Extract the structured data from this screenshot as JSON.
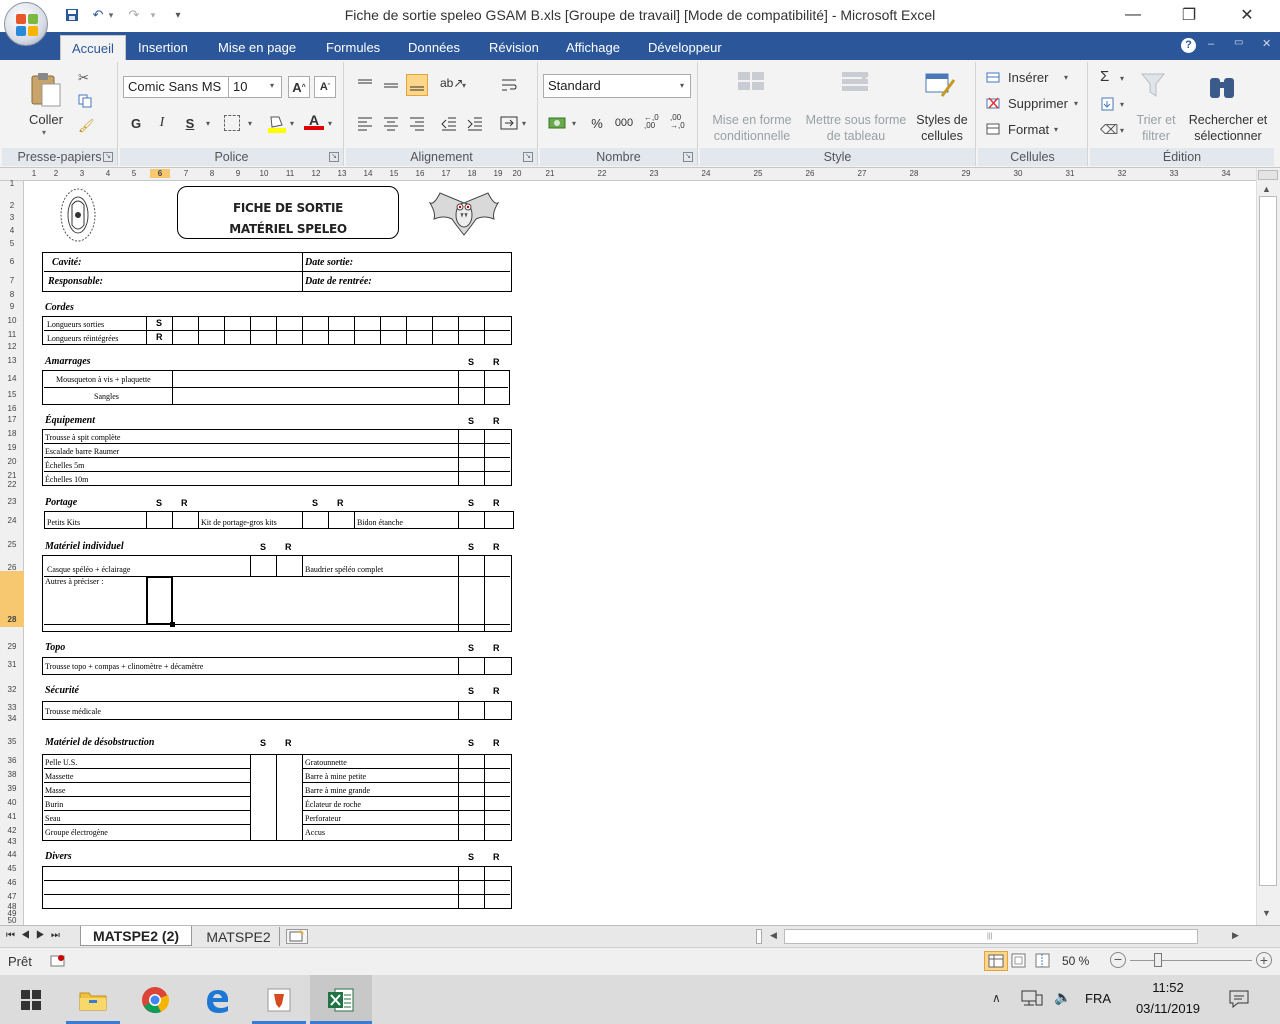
{
  "window": {
    "title": "Fiche de sortie speleo GSAM B.xls  [Groupe de travail]  [Mode de compatibilité] - Microsoft Excel",
    "minimize": "—",
    "maximize": "❐",
    "close": "✕"
  },
  "qat": {
    "save": "💾",
    "undo": "↶",
    "redo": "↷",
    "customize": "▾"
  },
  "tabs": [
    "Accueil",
    "Insertion",
    "Mise en page",
    "Formules",
    "Données",
    "Révision",
    "Affichage",
    "Développeur"
  ],
  "ribbon": {
    "clipboard": {
      "label": "Presse-papiers",
      "paste": "Coller"
    },
    "font": {
      "label": "Police",
      "font_name": "Comic Sans MS",
      "font_size": "10",
      "bold": "G",
      "italic": "I",
      "underline": "S"
    },
    "alignment": {
      "label": "Alignement"
    },
    "number": {
      "label": "Nombre",
      "format": "Standard",
      "percent": "%",
      "thousands": "000"
    },
    "style": {
      "label": "Style",
      "conditional": "Mise en forme conditionnelle",
      "table": "Mettre sous forme de tableau",
      "cell_styles": "Styles de cellules"
    },
    "cells": {
      "label": "Cellules",
      "insert": "Insérer",
      "delete": "Supprimer",
      "format": "Format"
    },
    "editing": {
      "label": "Édition",
      "sum": "Σ",
      "sort": "Trier et filtrer",
      "find": "Rechercher et sélectionner"
    }
  },
  "columns": [
    "1",
    "2",
    "3",
    "4",
    "5",
    "6",
    "7",
    "8",
    "9",
    "10",
    "11",
    "12",
    "13",
    "14",
    "15",
    "16",
    "17",
    "18",
    "19",
    "20",
    "21",
    "22",
    "23",
    "24",
    "25",
    "26",
    "27",
    "28",
    "29",
    "30",
    "31",
    "32",
    "33",
    "34"
  ],
  "rows": [
    "1",
    "2",
    "3",
    "4",
    "5",
    "6",
    "7",
    "8",
    "9",
    "10",
    "11",
    "12",
    "13",
    "14",
    "15",
    "16",
    "17",
    "18",
    "19",
    "20",
    "21",
    "22",
    "23",
    "24",
    "25",
    "26",
    "27",
    "28",
    "29",
    "31",
    "32",
    "33",
    "34",
    "35",
    "36",
    "38",
    "39",
    "40",
    "41",
    "42",
    "43",
    "44",
    "45",
    "46",
    "47",
    "48",
    "49",
    "50"
  ],
  "form": {
    "title_line1": "FICHE DE SORTIE",
    "title_line2": "MATÉRIEL SPELEO",
    "cavite": "Cavité:",
    "date_sortie": "Date  sortie:",
    "responsable": "Responsable:",
    "date_rentree": "Date de rentrée:",
    "cordes": "Cordes",
    "longueurs_sorties": "Longueurs sorties",
    "longueurs_reintegrees": "Longueurs réintégrées",
    "s": "S",
    "r": "R",
    "amarrages": "Amarrages",
    "mousqueton": "Mousqueton à vis + plaquette",
    "sangles": "Sangles",
    "equipement": "Équipement",
    "trousse_spit": "Trousse à spit complète",
    "escalade": "Escalade barre Raumer",
    "echelles5": "Échelles 5m",
    "echelles10": "Échelles 10m",
    "portage": "Portage",
    "petits_kits": "Petits Kits",
    "kit_portage": "Kit de portage-gros kits",
    "bidon": "Bidon étanche",
    "materiel_individuel": "Matériel individuel",
    "casque": "Casque spéléo + éclairage",
    "baudrier": "Baudrier spéléo complet",
    "autres": "Autres à préciser :",
    "topo": "Topo",
    "trousse_topo": "Trousse topo + compas + clinomètre + décamètre",
    "securite": "Sécurité",
    "trousse_medicale": "Trousse médicale",
    "desobstruction": "Matériel de désobstruction",
    "desob_left": [
      "Pelle U.S.",
      "Massette",
      "Masse",
      "Burin",
      "Seau",
      "Groupe électrogène"
    ],
    "desob_right": [
      "Gratounnette",
      "Barre à mine petite",
      "Barre à mine grande",
      "Éclateur de roche",
      "Perforateur",
      "Accus"
    ],
    "divers": "Divers"
  },
  "sheet_tabs": [
    "MATSPE2 (2)",
    "MATSPE2"
  ],
  "status": {
    "ready": "Prêt",
    "zoom": "50 %"
  },
  "taskbar": {
    "lang": "FRA",
    "time": "11:52",
    "date": "03/11/2019"
  }
}
